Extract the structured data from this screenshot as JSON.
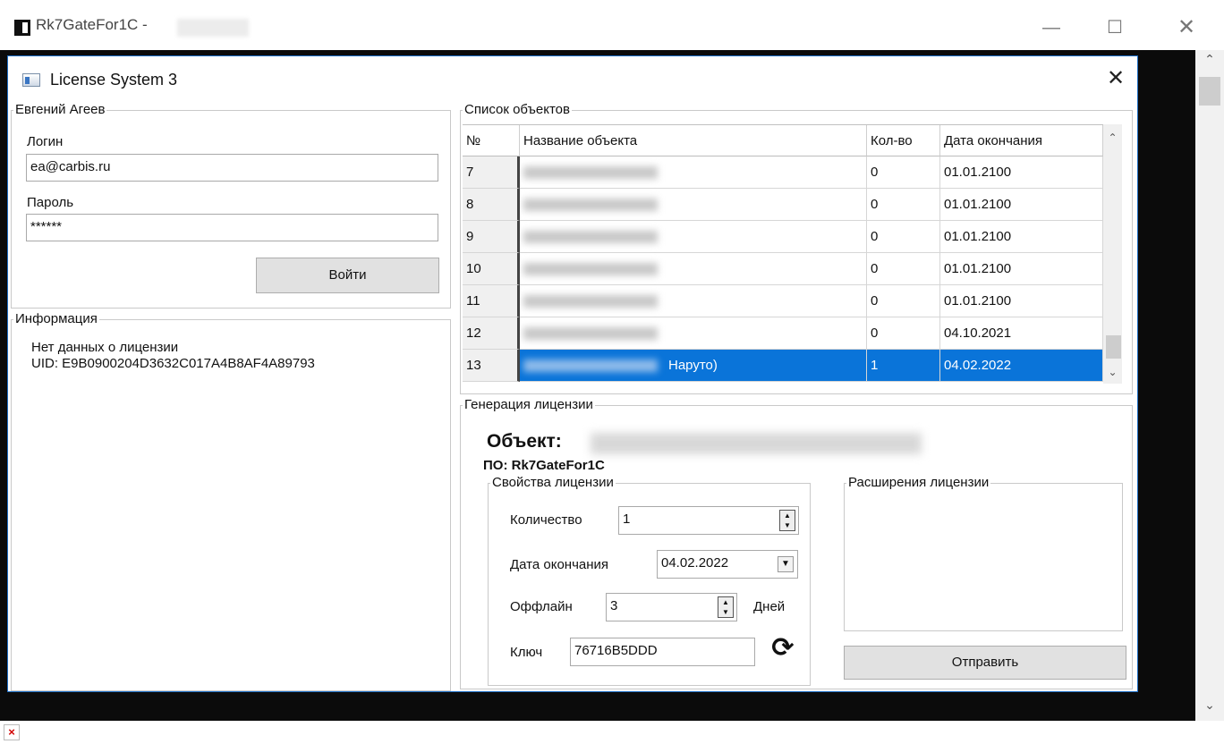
{
  "app": {
    "title": "Rk7GateFor1C -",
    "controls": {
      "minimize": "—",
      "maximize": "☐",
      "close": "✕"
    }
  },
  "dialog": {
    "title": "License System 3",
    "close": "✕"
  },
  "login": {
    "group_title": "Евгений Агеев",
    "login_label": "Логин",
    "login_value": "ea@carbis.ru",
    "password_label": "Пароль",
    "password_value": "******",
    "button": "Войти"
  },
  "info": {
    "group_title": "Информация",
    "line1": "Нет данных о лицензии",
    "line2": "UID: E9B0900204D3632C017A4B8AF4A89793"
  },
  "objects": {
    "group_title": "Список объектов",
    "columns": [
      "№",
      "Название объекта",
      "Кол-во",
      "Дата окончания"
    ],
    "rows": [
      {
        "no": "7",
        "name": "",
        "qty": "0",
        "date": "01.01.2100"
      },
      {
        "no": "8",
        "name": "",
        "qty": "0",
        "date": "01.01.2100"
      },
      {
        "no": "9",
        "name": "",
        "qty": "0",
        "date": "01.01.2100"
      },
      {
        "no": "10",
        "name": "",
        "qty": "0",
        "date": "01.01.2100"
      },
      {
        "no": "11",
        "name": "",
        "qty": "0",
        "date": "01.01.2100"
      },
      {
        "no": "12",
        "name": "",
        "qty": "0",
        "date": "04.10.2021"
      },
      {
        "no": "13",
        "name": "Наруто)",
        "qty": "1",
        "date": "04.02.2022"
      }
    ],
    "selected_row": "13"
  },
  "generation": {
    "group_title": "Генерация лицензии",
    "object_label": "Объект:",
    "software_label": "ПО: Rk7GateFor1C",
    "properties": {
      "group_title": "Свойства лицензии",
      "qty_label": "Количество",
      "qty_value": "1",
      "end_date_label": "Дата окончания",
      "end_date_value": "04.02.2022",
      "offline_label": "Оффлайн",
      "offline_value": "3",
      "days_label": "Дней",
      "key_label": "Ключ",
      "key_value": "76716B5DDD"
    },
    "extensions_title": "Расширения лицензии",
    "send_button": "Отправить"
  },
  "colors": {
    "selection": "#0a74d9",
    "dialog_border": "#1e6fc6"
  }
}
